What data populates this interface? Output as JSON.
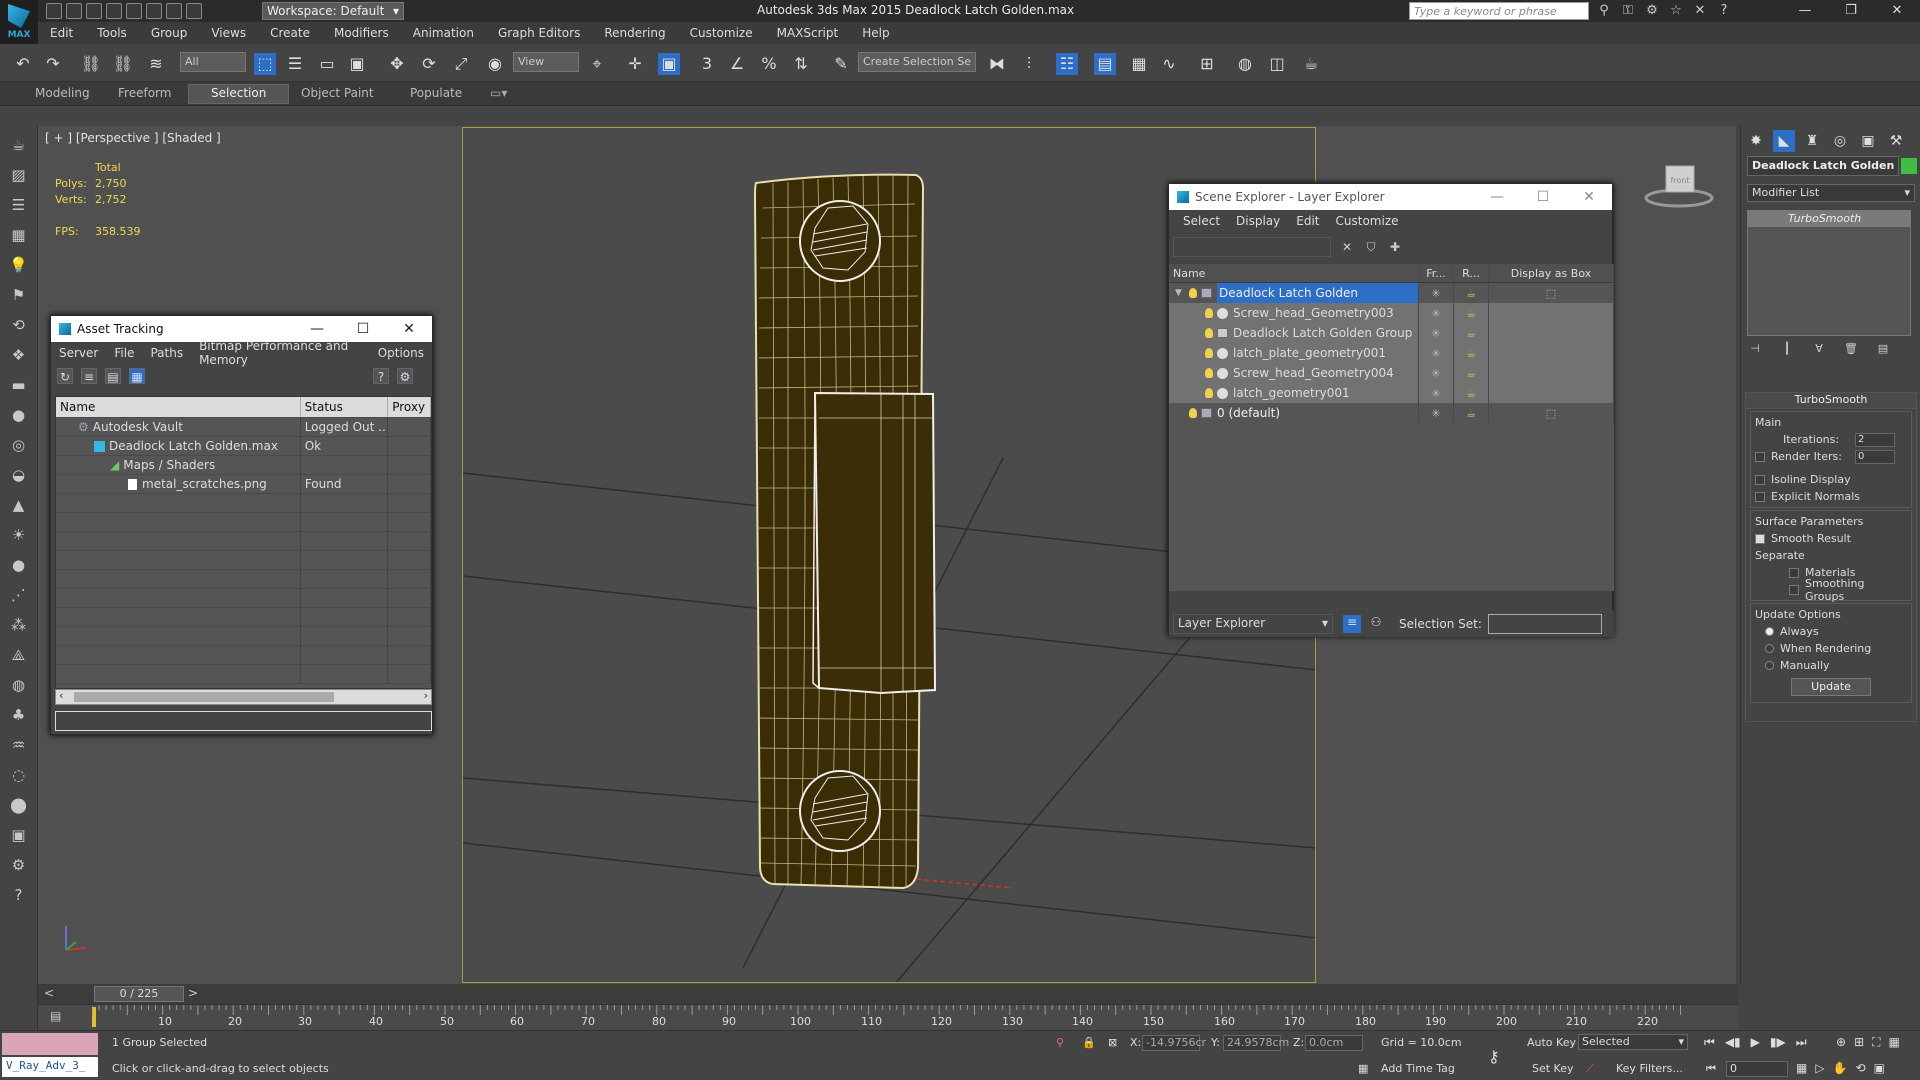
{
  "app": {
    "title": "Autodesk 3ds Max  2015    Deadlock Latch Golden.max",
    "logo": "MAX",
    "workspace": "Workspace: Default",
    "search_placeholder": "Type a keyword or phrase"
  },
  "menu": [
    "Edit",
    "Tools",
    "Group",
    "Views",
    "Create",
    "Modifiers",
    "Animation",
    "Graph Editors",
    "Rendering",
    "Customize",
    "MAXScript",
    "Help"
  ],
  "toolbar": {
    "filter": "All",
    "ref_coord": "View",
    "selection_set": "Create Selection Se"
  },
  "ribbon": {
    "tabs": [
      "Modeling",
      "Freeform",
      "Selection",
      "Object Paint",
      "Populate"
    ],
    "active": "Selection"
  },
  "viewport": {
    "label": "[ + ] [Perspective ] [Shaded ]",
    "stats": {
      "total": "Total",
      "polys_label": "Polys:",
      "polys": "2,750",
      "verts_label": "Verts:",
      "verts": "2,752",
      "fps_label": "FPS:",
      "fps": "358.539"
    },
    "viewcube_label": "front"
  },
  "asset_tracking": {
    "title": "Asset Tracking",
    "menu": [
      "Server",
      "File",
      "Paths",
      "Bitmap Performance and Memory",
      "Options"
    ],
    "columns": [
      "Name",
      "Status",
      "Proxy R"
    ],
    "rows": [
      {
        "name": "Autodesk Vault",
        "status": "Logged Out ...",
        "indent": 1
      },
      {
        "name": "Deadlock Latch Golden.max",
        "status": "Ok",
        "indent": 2
      },
      {
        "name": "Maps / Shaders",
        "status": "",
        "indent": 3
      },
      {
        "name": "metal_scratches.png",
        "status": "Found",
        "indent": 4
      }
    ]
  },
  "scene_explorer": {
    "title": "Scene Explorer - Layer Explorer",
    "menu": [
      "Select",
      "Display",
      "Edit",
      "Customize"
    ],
    "columns": [
      "Name",
      "Fr...",
      "R...",
      "Display as Box"
    ],
    "rows": [
      {
        "name": "Deadlock Latch Golden",
        "type": "layer",
        "selected": true
      },
      {
        "name": "Screw_head_Geometry003",
        "type": "object"
      },
      {
        "name": "Deadlock Latch Golden Group",
        "type": "group"
      },
      {
        "name": "latch_plate_geometry001",
        "type": "object"
      },
      {
        "name": "Screw_head_Geometry004",
        "type": "object"
      },
      {
        "name": "latch_geometry001",
        "type": "object"
      },
      {
        "name": "0 (default)",
        "type": "layer"
      }
    ],
    "footer_mode": "Layer Explorer",
    "selection_set_label": "Selection Set:"
  },
  "command_panel": {
    "object_name": "Deadlock Latch Golden Gr",
    "object_color": "#3fbf3f",
    "modifier_list": "Modifier List",
    "stack": [
      "TurboSmooth"
    ],
    "rollout_title": "TurboSmooth",
    "main_label": "Main",
    "iterations_label": "Iterations:",
    "iterations": "2",
    "render_iters_label": "Render Iters:",
    "render_iters": "0",
    "isoline": "Isoline Display",
    "explicit_normals": "Explicit Normals",
    "surface_params": "Surface Parameters",
    "smooth_result": "Smooth Result",
    "separate": "Separate",
    "materials": "Materials",
    "smoothing_groups": "Smoothing Groups",
    "update_options": "Update Options",
    "always": "Always",
    "when_rendering": "When Rendering",
    "manually": "Manually",
    "update_btn": "Update"
  },
  "timeline": {
    "slider": "0 / 225",
    "ticks": [
      "10",
      "20",
      "30",
      "40",
      "50",
      "60",
      "70",
      "80",
      "90",
      "100",
      "110",
      "120",
      "130",
      "140",
      "150",
      "160",
      "170",
      "180",
      "190",
      "200",
      "210",
      "220"
    ]
  },
  "status": {
    "maxscript": "V_Ray_Adv_3_",
    "selected": "1 Group Selected",
    "prompt": "Click or click-and-drag to select objects",
    "x_label": "X:",
    "x": "-14.9756cr",
    "y_label": "Y:",
    "y": "24.9578cm",
    "z_label": "Z:",
    "z": "0.0cm",
    "grid": "Grid = 10.0cm",
    "add_time_tag": "Add Time Tag",
    "auto_key": "Auto Key",
    "set_key": "Set Key",
    "key_mode": "Selected",
    "key_filters": "Key Filters...",
    "frame": "0"
  }
}
